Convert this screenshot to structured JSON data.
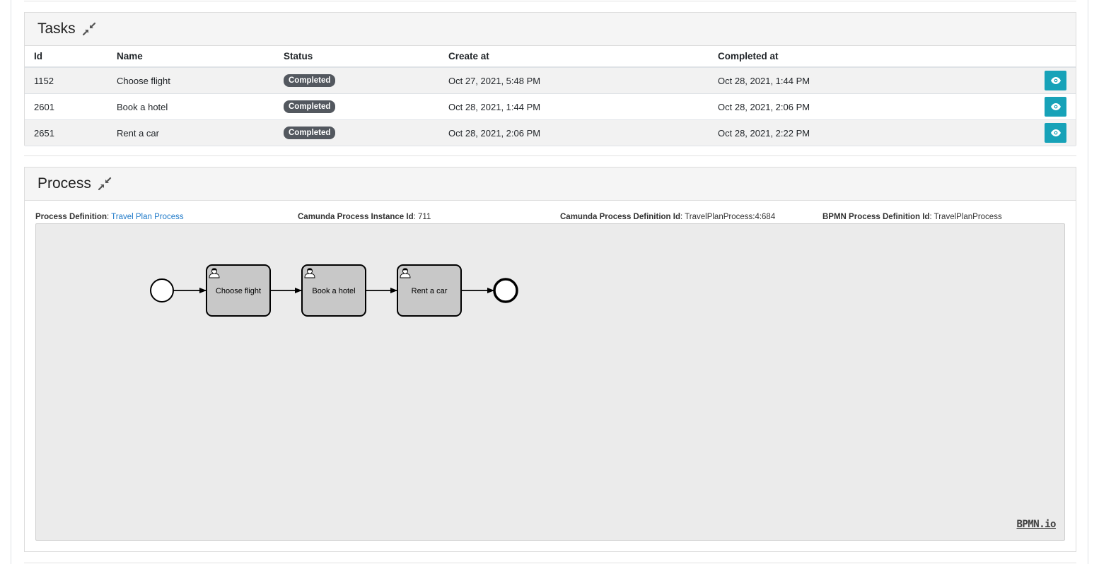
{
  "tasks": {
    "title": "Tasks",
    "columns": [
      "Id",
      "Name",
      "Status",
      "Create at",
      "Completed at"
    ],
    "rows": [
      {
        "id": "1152",
        "name": "Choose flight",
        "status": "Completed",
        "created": "Oct 27, 2021, 5:48 PM",
        "completed": "Oct 28, 2021, 1:44 PM"
      },
      {
        "id": "2601",
        "name": "Book a hotel",
        "status": "Completed",
        "created": "Oct 28, 2021, 1:44 PM",
        "completed": "Oct 28, 2021, 2:06 PM"
      },
      {
        "id": "2651",
        "name": "Rent a car",
        "status": "Completed",
        "created": "Oct 28, 2021, 2:06 PM",
        "completed": "Oct 28, 2021, 2:22 PM"
      }
    ]
  },
  "process": {
    "title": "Process",
    "definition_label": "Process Definition",
    "definition_value": "Travel Plan Process",
    "instance_label": "Camunda Process Instance Id",
    "instance_value": "711",
    "camunda_def_label": "Camunda Process Definition Id",
    "camunda_def_value": "TravelPlanProcess:4:684",
    "bpmn_def_label": "BPMN Process Definition Id",
    "bpmn_def_value": "TravelPlanProcess",
    "diagram": {
      "tasks": [
        "Choose flight",
        "Book a hotel",
        "Rent a car"
      ]
    },
    "logo": "BPMN.io"
  },
  "colors": {
    "badge": "#53585f",
    "view_button": "#17a2b8",
    "link": "#1f7ac9",
    "canvas": "#ebebeb",
    "task_fill": "#c8c8c8"
  },
  "icons": {
    "collapse": "compress-icon",
    "view": "eye-icon",
    "user_task": "user-icon"
  }
}
